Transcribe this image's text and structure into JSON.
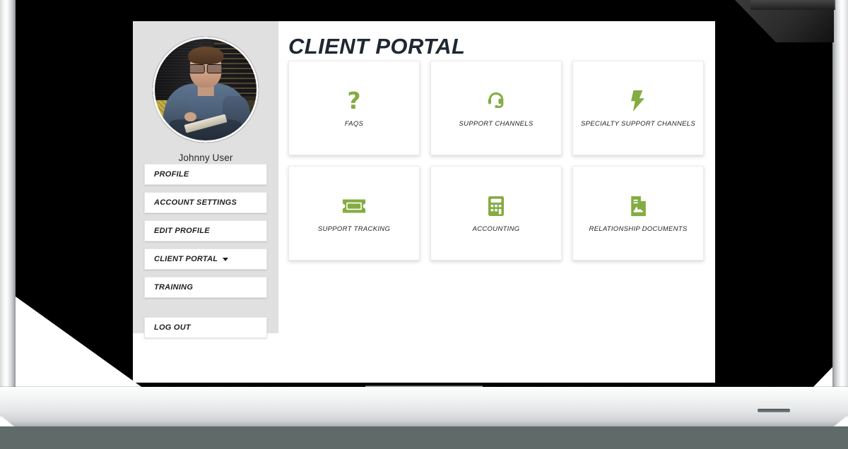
{
  "device": {
    "type": "laptop-mockup",
    "frame_color": "#000000",
    "base_color": "#eceeef",
    "desk_color": "#5f6a69"
  },
  "theme": {
    "accent_green": "#84ac42",
    "sidebar_bg": "#e0e0e0",
    "title_color": "#1f2733",
    "card_bg": "#ffffff"
  },
  "sidebar": {
    "avatar_alt": "Photo of a man with glasses in a blue shirt seated in a chair",
    "user_name": "Johnny User",
    "items": [
      {
        "label": "PROFILE",
        "has_caret": false
      },
      {
        "label": "ACCOUNT SETTINGS",
        "has_caret": false
      },
      {
        "label": "EDIT PROFILE",
        "has_caret": false
      },
      {
        "label": "CLIENT PORTAL",
        "has_caret": true
      },
      {
        "label": "TRAINING",
        "has_caret": false
      }
    ],
    "logout": {
      "label": "LOG OUT",
      "has_caret": false
    }
  },
  "main": {
    "title": "CLIENT PORTAL",
    "cards": [
      {
        "label": "FAQS",
        "icon": "question-mark-icon"
      },
      {
        "label": "SUPPORT CHANNELS",
        "icon": "headset-icon"
      },
      {
        "label": "SPECIALTY SUPPORT CHANNELS",
        "icon": "lightning-bolt-icon"
      },
      {
        "label": "SUPPORT TRACKING",
        "icon": "ticket-icon"
      },
      {
        "label": "ACCOUNTING",
        "icon": "calculator-icon"
      },
      {
        "label": "RELATIONSHIP DOCUMENTS",
        "icon": "signed-document-icon"
      }
    ]
  }
}
